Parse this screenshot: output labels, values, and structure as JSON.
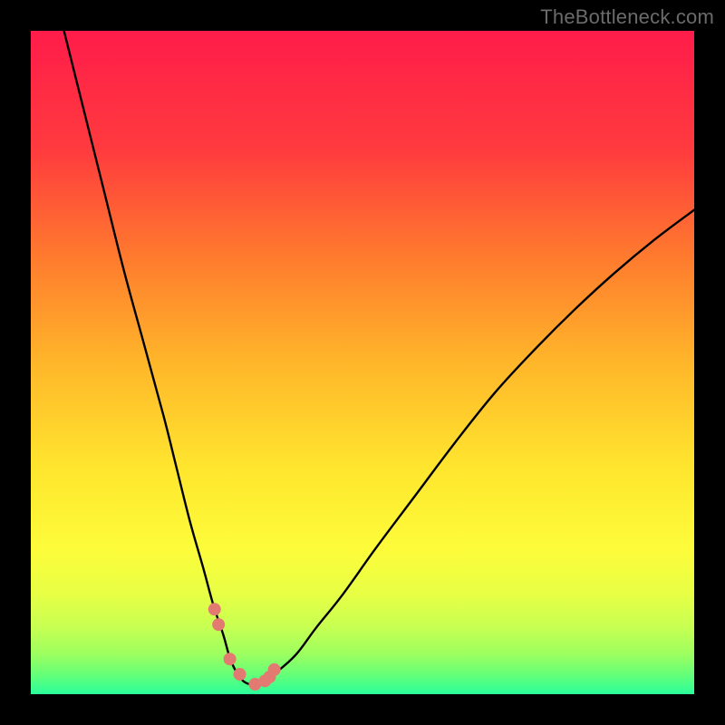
{
  "watermark": "TheBottleneck.com",
  "chart_data": {
    "type": "line",
    "title": "",
    "xlabel": "",
    "ylabel": "",
    "xlim": [
      0,
      100
    ],
    "ylim": [
      0,
      100
    ],
    "series": [
      {
        "name": "curve",
        "x": [
          5,
          8,
          11,
          14,
          17,
          20,
          22,
          24,
          26,
          27.5,
          29,
          30,
          31,
          32,
          33,
          34,
          35,
          37,
          40,
          43,
          47,
          52,
          58,
          64,
          70,
          76,
          82,
          88,
          94,
          100
        ],
        "values": [
          100,
          88,
          76,
          64,
          53,
          42,
          34,
          26,
          19,
          13.5,
          9,
          5.5,
          3.3,
          2,
          1.5,
          1.5,
          2,
          3.3,
          6,
          10,
          15,
          22,
          30,
          38,
          45.5,
          52,
          58,
          63.5,
          68.5,
          73
        ]
      }
    ],
    "markers": {
      "name": "highlighted-points",
      "x": [
        27.7,
        28.3,
        30.0,
        31.5,
        33.8,
        35.3,
        36.0,
        36.7
      ],
      "values": [
        12.8,
        10.5,
        5.3,
        3.0,
        1.5,
        2.0,
        2.6,
        3.7
      ],
      "color": "#e27a72",
      "radius": 7
    },
    "background": {
      "type": "vertical-gradient",
      "stops": [
        {
          "offset": 0.0,
          "color": "#ff1c4a"
        },
        {
          "offset": 0.18,
          "color": "#ff3b3e"
        },
        {
          "offset": 0.34,
          "color": "#ff7a2e"
        },
        {
          "offset": 0.5,
          "color": "#ffb62a"
        },
        {
          "offset": 0.66,
          "color": "#ffe62e"
        },
        {
          "offset": 0.78,
          "color": "#fdfc3a"
        },
        {
          "offset": 0.85,
          "color": "#e7ff45"
        },
        {
          "offset": 0.9,
          "color": "#c6ff52"
        },
        {
          "offset": 0.94,
          "color": "#9cff60"
        },
        {
          "offset": 0.97,
          "color": "#66ff78"
        },
        {
          "offset": 1.0,
          "color": "#2aff9a"
        }
      ]
    }
  }
}
